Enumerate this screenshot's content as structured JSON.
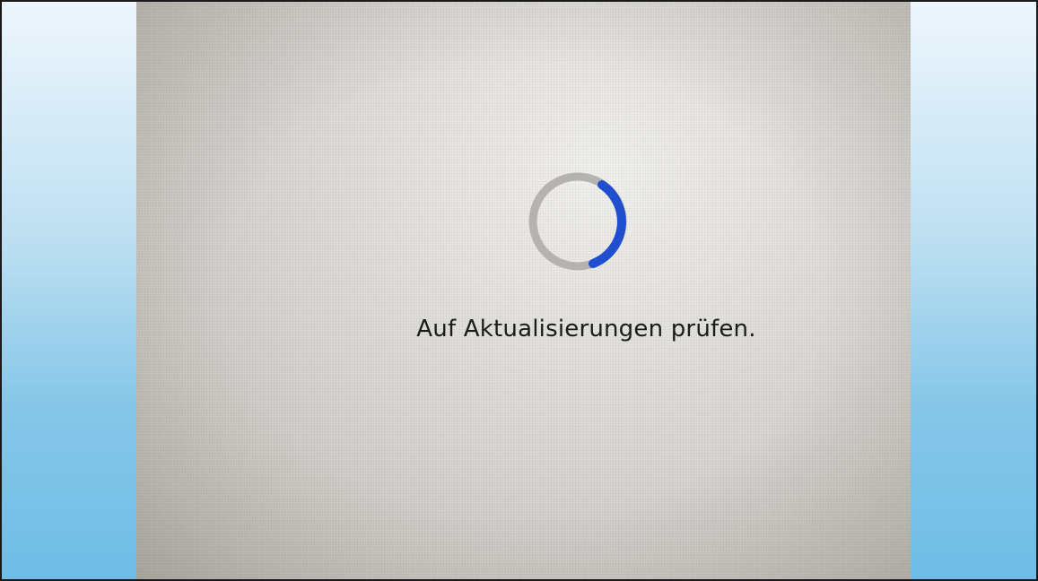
{
  "status": {
    "message": "Auf Aktualisierungen prüfen."
  },
  "spinner": {
    "icon": "loading-spinner-icon",
    "track_color": "#b5b3b0",
    "accent_color": "#1f4fcf"
  },
  "colors": {
    "side_panel_top": "#eef6fc",
    "side_panel_bottom": "#6fbde6"
  }
}
